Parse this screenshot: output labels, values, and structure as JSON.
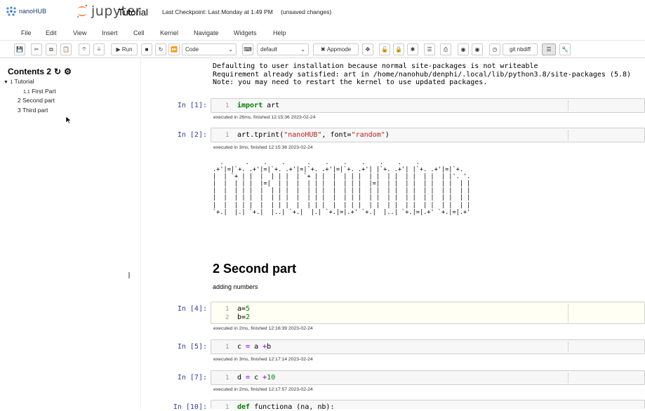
{
  "header": {
    "brand": "nanoHUB",
    "jupyter_word": "jupyter",
    "notebook_name": "Tutorial",
    "checkpoint": "Last Checkpoint: Last Monday at 1:49 PM",
    "unsaved": "(unsaved changes)"
  },
  "menu": [
    "File",
    "Edit",
    "View",
    "Insert",
    "Cell",
    "Kernel",
    "Navigate",
    "Widgets",
    "Help"
  ],
  "toolbar": {
    "run_label": "Run",
    "cell_type": "Code",
    "style_select": "default",
    "appmode_label": "Appmode",
    "nbdiff_label": "nbdiff",
    "git_prefix": "git"
  },
  "toc": {
    "title": "Contents 2",
    "items": [
      {
        "num": "1",
        "label": "Tutorial"
      },
      {
        "num": "1.1",
        "label": "First Part"
      },
      {
        "num": "2",
        "label": "Second part"
      },
      {
        "num": "3",
        "label": "Third part"
      }
    ]
  },
  "cells": {
    "pre_output": [
      "Defaulting to user installation because normal site-packages is not writeable",
      "Requirement already satisfied: art in /home/nanohub/denphi/.local/lib/python3.8/site-packages (5.8)",
      "Note: you may need to restart the kernel to use updated packages."
    ],
    "c1": {
      "prompt": "In [1]:",
      "line": "1",
      "kw": "import",
      "rest": " art",
      "exec": "executed in 26ms, finished 12:15:36 2023-02-24"
    },
    "c2": {
      "prompt": "In [2]:",
      "line": "1",
      "pre": "art.tprint(",
      "s1": "\"nanoHUB\"",
      "mid": ", font=",
      "s2": "\"random\"",
      "post": ")",
      "exec": "executed in 3ms, finished 12:15:36 2023-02-24"
    },
    "ascii": [
      "  .      .    .    .      .    .    .    .    .    .    .",
      ".+'|=|`+. .+'|=|`+. .+'|=|`+. .+'|=|`+. .+'| |`+. .+'| |`+. .+'|=|`+.",
      "|  | `+ | |  |  | | |  | `+ | |  |  | | |  | |  | |  | |  | |  | |'. '.",
      "|  |  | | |  |=|  | |  |  | | |  |  | | |  |=|  | |  | |  | |  | |  | |",
      "|  |  | | |  |  | | |  |  | | |  |  | | |  | |  | |  | |  | |  | |  | |",
      "|  |  | | |  |  | | |  |  | | |  |  | | |  | |  | |  | |  | |  | |  | |",
      "|  |  | | |  |  | | |  |  | | |  |  | | |  | |  | |  | |  | |  | |  | |",
      "`+.|  |.| `+.|  |..| `+.|  |.| `+.|=|.+' `+.|  |..| `+.|=|.+' `+.|=|.+'"
    ],
    "md_heading": "2  Second part",
    "md_text": "adding numbers",
    "c4": {
      "prompt": "In [4]:",
      "lines": [
        {
          "n": "1",
          "var": "a=",
          "val": "5"
        },
        {
          "n": "2",
          "var": "b=",
          "val": "2"
        }
      ],
      "exec": "executed in 2ms, finished 12:16:39 2023-02-24"
    },
    "c5": {
      "prompt": "In [5]:",
      "line": "1",
      "code_a": "c ",
      "op1": "=",
      "code_b": " a ",
      "op2": "+",
      "code_c": "b",
      "exec": "executed in 3ms, finished 12:17:14 2023-02-24"
    },
    "c7": {
      "prompt": "In [7]:",
      "line": "1",
      "code_a": "d ",
      "op1": "=",
      "code_b": " c ",
      "op2": "+",
      "val": "10",
      "exec": "executed in 2ms, finished 12:17:57 2023-02-24"
    },
    "c10": {
      "prompt": "In [10]:",
      "line": "1",
      "kw": "def",
      "rest": " functiona (na, nb):"
    }
  }
}
